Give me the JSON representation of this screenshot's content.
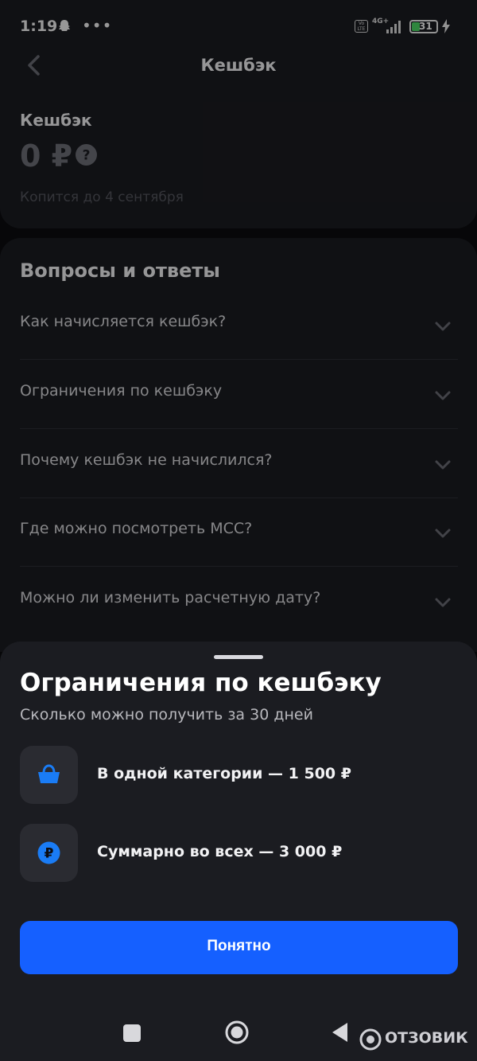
{
  "status_bar": {
    "time": "1:19",
    "network": "4G+",
    "volte": "Vo LTE",
    "battery": "31",
    "icons": [
      "snapchat-ghost-icon",
      "more-dots-icon",
      "signal-icon",
      "battery-icon",
      "charging-bolt-icon"
    ]
  },
  "header": {
    "title": "Кешбэк",
    "back_icon": "chevron-left-icon"
  },
  "cashback": {
    "label": "Кешбэк",
    "amount": "0 ₽",
    "accumulates": "Копится до 4 сентября",
    "help_icon": "question-circle-icon"
  },
  "faq": {
    "title": "Вопросы и ответы",
    "items": [
      {
        "question": "Как начисляется кешбэк?"
      },
      {
        "question": "Ограничения по кешбэку"
      },
      {
        "question": "Почему кешбэк не начислился?"
      },
      {
        "question": "Где можно посмотреть МСС?"
      },
      {
        "question": "Можно ли изменить расчетную дату?"
      }
    ]
  },
  "sheet": {
    "title": "Ограничения по кешбэку",
    "subtitle": "Сколько можно получить за 30 дней",
    "limits": [
      {
        "icon": "shopping-basket-icon",
        "text": "В одной категории — 1 500 ₽"
      },
      {
        "icon": "ruble-coin-icon",
        "text": "Суммарно во всех — 3 000 ₽"
      }
    ],
    "button_label": "Понятно"
  },
  "nav_bar": {
    "icons": [
      "recent-apps-icon",
      "home-icon",
      "back-triangle-icon"
    ]
  },
  "watermark": {
    "text": "ОТЗОВИК"
  },
  "colors": {
    "background": "#0c0c0f",
    "card": "#1b1c21",
    "accent_blue": "#1560ff",
    "icon_blue": "#1a7cf5",
    "muted_text": "#55565e"
  }
}
